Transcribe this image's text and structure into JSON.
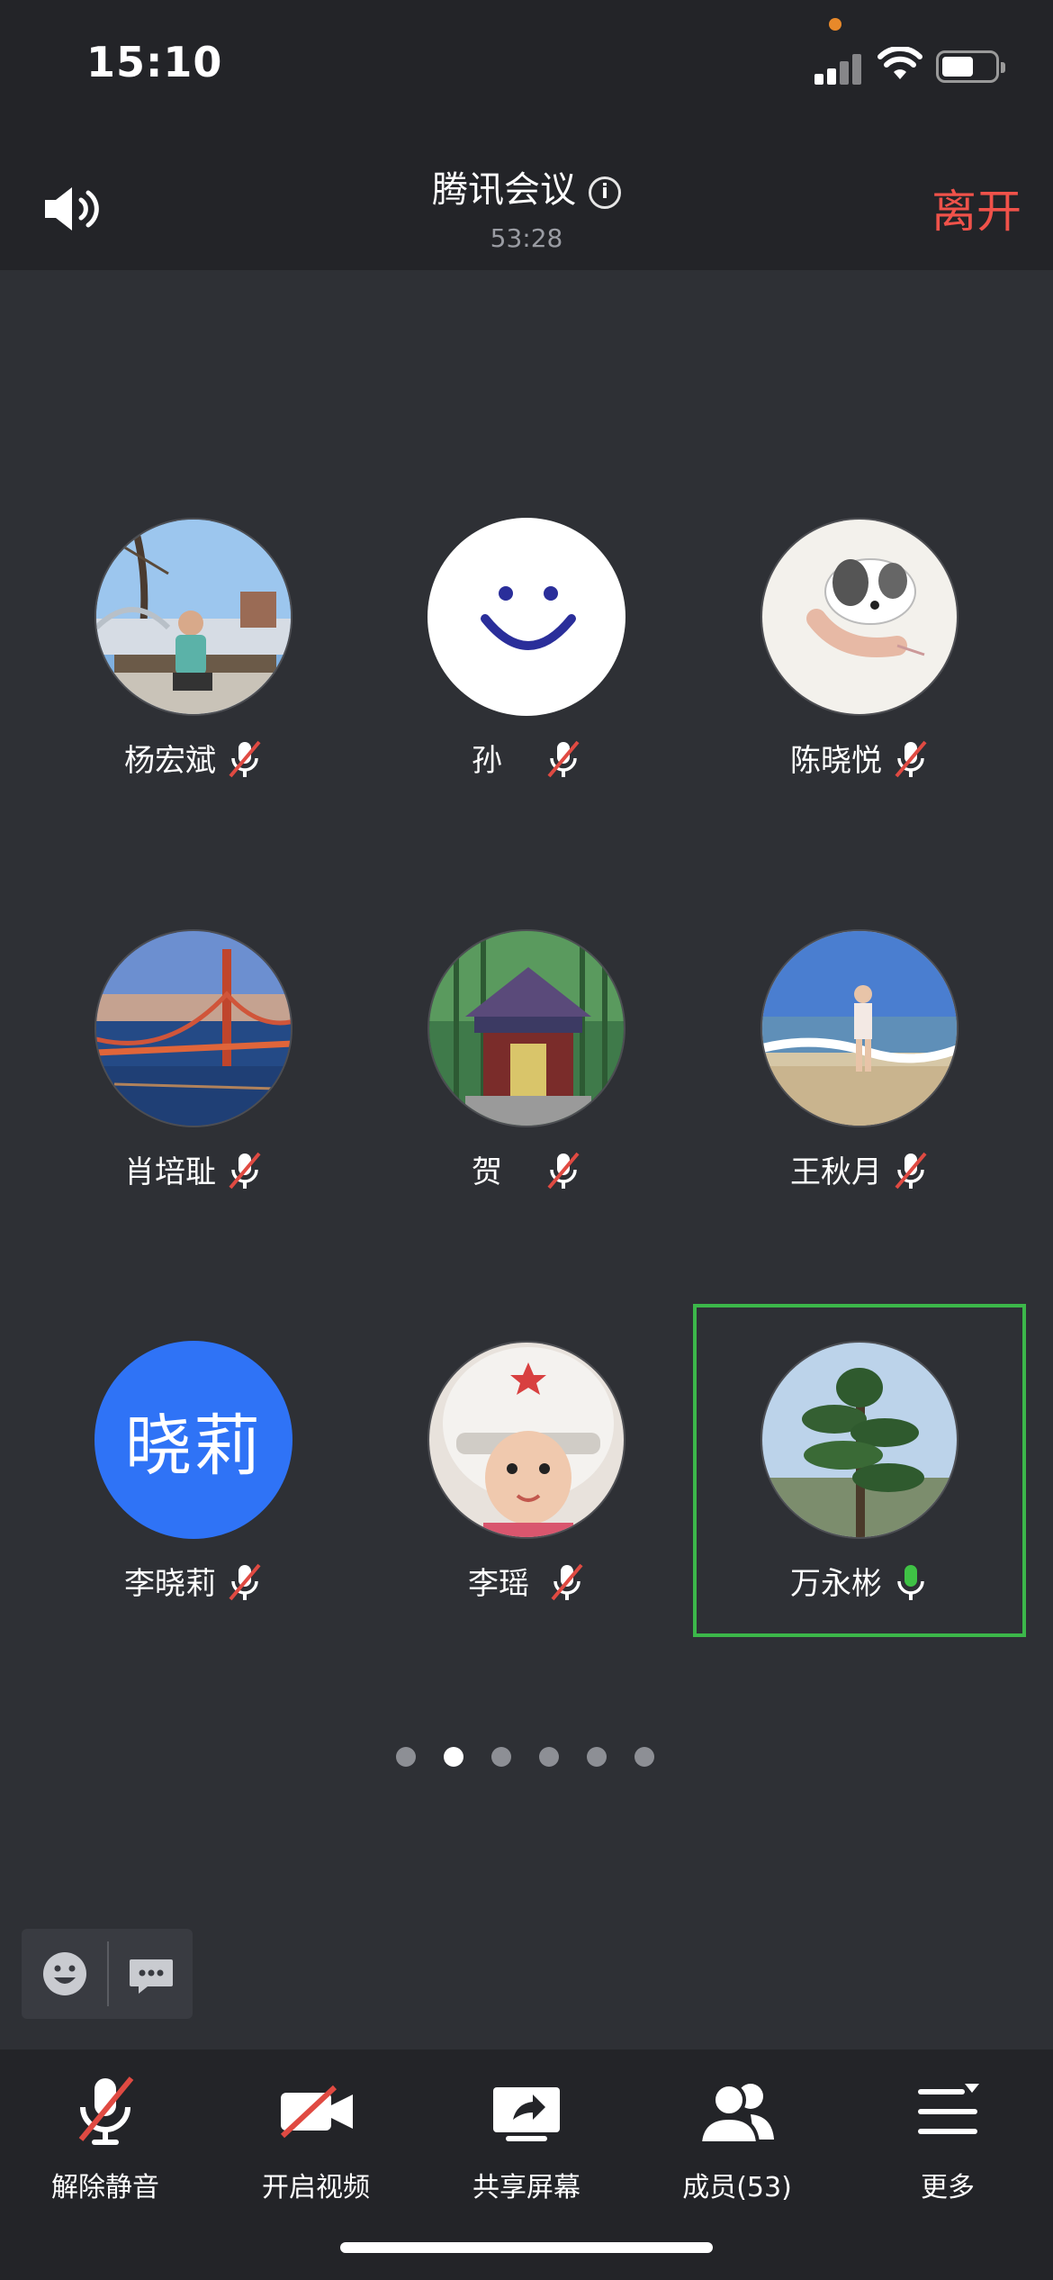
{
  "status_bar": {
    "time": "15:10"
  },
  "header": {
    "title": "腾讯会议",
    "duration": "53:28",
    "leave_label": "离开"
  },
  "participants": [
    {
      "name": "杨宏斌",
      "mic": "muted",
      "avatar": "photo-man-sitting-on-bench"
    },
    {
      "name": "孙",
      "mic": "muted",
      "avatar": "smiley-face"
    },
    {
      "name": "陈晓悦",
      "mic": "muted",
      "avatar": "puppy-drawing"
    },
    {
      "name": "肖培耻",
      "mic": "muted",
      "avatar": "golden-gate-bridge"
    },
    {
      "name": "贺",
      "mic": "muted",
      "avatar": "pavilion-in-forest"
    },
    {
      "name": "王秋月",
      "mic": "muted",
      "avatar": "person-on-beach"
    },
    {
      "name": "李晓莉",
      "mic": "muted",
      "avatar_text": "晓莉"
    },
    {
      "name": "李瑶",
      "mic": "muted",
      "avatar": "child-in-helmet"
    },
    {
      "name": "万永彬",
      "mic": "active",
      "avatar": "pine-tree",
      "speaking": true
    }
  ],
  "pagination": {
    "count": 6,
    "active_index": 1
  },
  "toolbar": {
    "unmute_label": "解除静音",
    "video_label": "开启视频",
    "share_label": "共享屏幕",
    "members_label": "成员(53)",
    "more_label": "更多"
  },
  "colors": {
    "background": "#2e3035",
    "bar": "#232428",
    "leave": "#f0524a",
    "active_speaker": "#3cb74a",
    "mic_active": "#3fc245",
    "mute_slash": "#e04a42",
    "initials_avatar": "#2f73f6"
  }
}
